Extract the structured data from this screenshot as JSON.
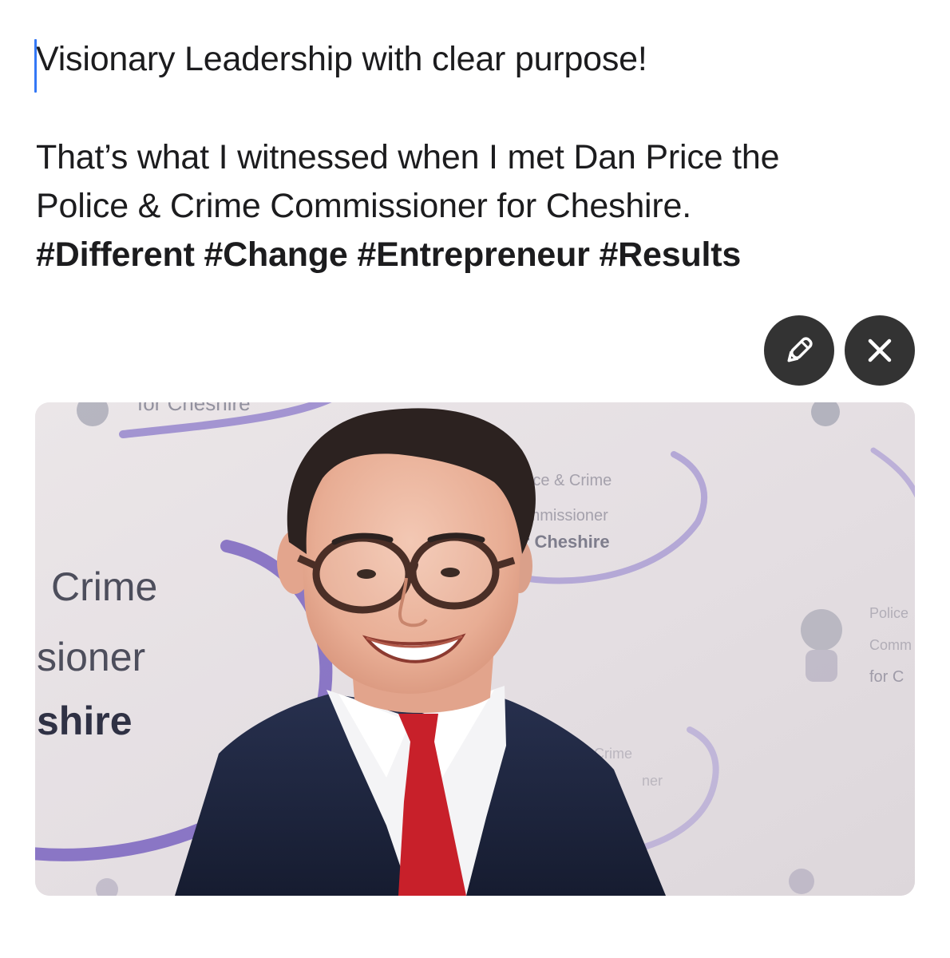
{
  "post": {
    "line1": "Visionary Leadership with clear purpose!",
    "line2": "That’s what I witnessed when I met Dan Price the",
    "line3": "Police & Crime Commissioner for Cheshire.",
    "hashtags": "#Different #Change #Entrepreneur #Results"
  },
  "attachment": {
    "icons": {
      "edit": "pencil-icon",
      "remove": "close-icon"
    },
    "backdrop_text": {
      "top_left": "for Cheshire",
      "left_crime": "Crime",
      "left_sioner": "sioner",
      "left_shire": "shire",
      "mid_police": "Police & Crime",
      "mid_commissioner": "Commissioner",
      "mid_for": "for Cheshire",
      "right_police": "Police",
      "right_comm": "Comm",
      "right_for": "for C",
      "bottom_crime": "Crime",
      "bottom_ner": "ner"
    },
    "colors": {
      "caret": "#3478f6",
      "button_bg": "#333333",
      "accent_purple": "#6a55b5",
      "tie_red": "#c8202a",
      "suit_navy": "#1d2640"
    }
  }
}
